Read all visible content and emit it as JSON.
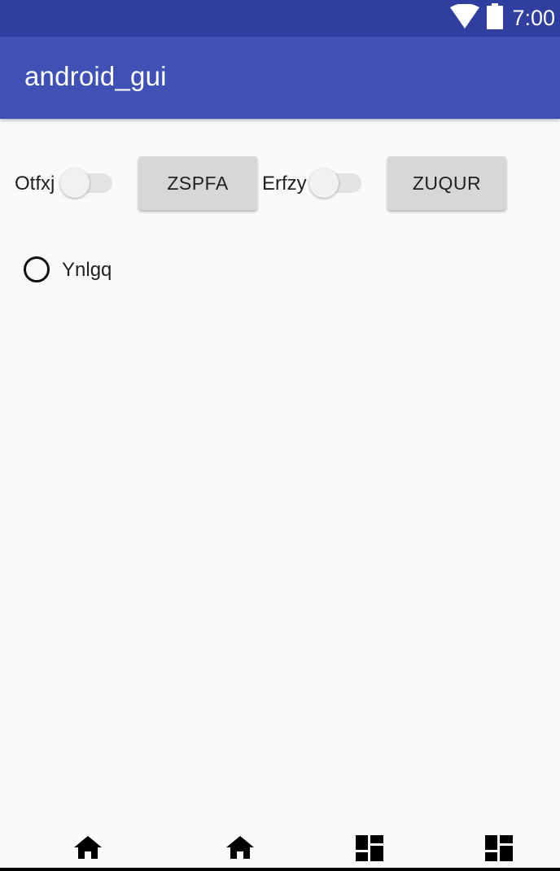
{
  "status_bar": {
    "time": "7:00",
    "icons": [
      "wifi-icon",
      "battery-icon"
    ],
    "background": "#303f9f"
  },
  "app_bar": {
    "title": "android_gui",
    "background": "#3f51b5"
  },
  "controls": {
    "switch1": {
      "label": "Otfxj",
      "checked": false
    },
    "button1": {
      "label": "ZSPFA"
    },
    "switch2": {
      "label": "Erfzy",
      "checked": false
    },
    "button2": {
      "label": "ZUQUR"
    },
    "radio1": {
      "label": "Ynlgq",
      "checked": false
    }
  },
  "nav_bar": {
    "icons": [
      "home-icon",
      "home-icon",
      "dashboard-icon",
      "dashboard-icon"
    ]
  }
}
